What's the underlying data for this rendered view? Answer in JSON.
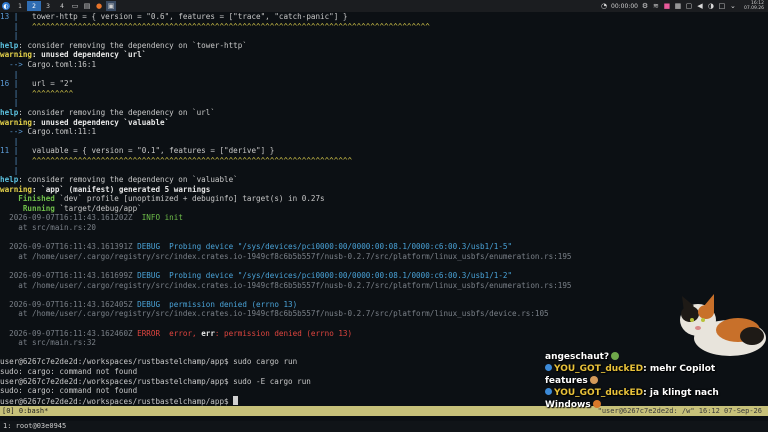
{
  "taskbar": {
    "workspaces": [
      "1",
      "2",
      "3",
      "4"
    ],
    "active_workspace": "2",
    "timer": "00:00:00",
    "clock_time": "16:12",
    "clock_date": "07.09.26"
  },
  "terminal": {
    "lines": [
      {
        "type": "code",
        "num": "13",
        "text": "tower-http = { version = \"0.6\", features = [\"trace\", \"catch-panic\"] }"
      },
      {
        "type": "under",
        "text": "^^^^^^^^^^^^^^^^^^^^^^^^^^^^^^^^^^^^^^^^^^^^^^^^^^^^^^^^^^^^^^^^^^^^^^^^^^^^^^^^^^^^^^^"
      },
      {
        "type": "bar"
      },
      {
        "type": "help",
        "label": "help",
        "text": ": consider removing the dependency on `tower-http`"
      },
      {
        "type": "warn",
        "label": "warning",
        "text": ": unused dependency `url`"
      },
      {
        "type": "arrow",
        "text": "Cargo.toml:16:1"
      },
      {
        "type": "bar"
      },
      {
        "type": "code",
        "num": "16",
        "text": "url = \"2\""
      },
      {
        "type": "under",
        "text": "^^^^^^^^^"
      },
      {
        "type": "bar"
      },
      {
        "type": "help",
        "label": "help",
        "text": ": consider removing the dependency on `url`"
      },
      {
        "type": "warn",
        "label": "warning",
        "text": ": unused dependency `valuable`"
      },
      {
        "type": "arrow",
        "text": "Cargo.toml:11:1"
      },
      {
        "type": "bar"
      },
      {
        "type": "code",
        "num": "11",
        "text": "valuable = { version = \"0.1\", features = [\"derive\"] }"
      },
      {
        "type": "under",
        "text": "^^^^^^^^^^^^^^^^^^^^^^^^^^^^^^^^^^^^^^^^^^^^^^^^^^^^^^^^^^^^^^^^^^^^^^"
      },
      {
        "type": "bar"
      },
      {
        "type": "help",
        "label": "help",
        "text": ": consider removing the dependency on `valuable`"
      },
      {
        "type": "warn",
        "label": "warning",
        "text": ": `app` (manifest) generated 5 warnings"
      },
      {
        "type": "status",
        "label": "    Finished",
        "text": " `dev` profile [unoptimized + debuginfo] target(s) in 0.27s"
      },
      {
        "type": "status",
        "label": "     Running",
        "text": " `target/debug/app`"
      },
      {
        "type": "log",
        "ts": "  2026-09-07T16:11:43.161202Z",
        "level": "  INFO",
        "lvl": "info",
        "msg": " init",
        "msgcls": "info"
      },
      {
        "type": "at",
        "text": "    at src/main.rs:20"
      },
      {
        "type": "blank"
      },
      {
        "type": "log",
        "ts": "  2026-09-07T16:11:43.161391Z",
        "level": " DEBUG",
        "lvl": "debug",
        "msg": "  Probing device \"/sys/devices/pci0000:00/0000:00:08.1/0000:c6:00.3/usb1/1-5\"",
        "msgcls": "debug"
      },
      {
        "type": "at",
        "text": "    at /home/user/.cargo/registry/src/index.crates.io-1949cf8c6b5b557f/nusb-0.2.7/src/platform/linux_usbfs/enumeration.rs:195"
      },
      {
        "type": "blank"
      },
      {
        "type": "log",
        "ts": "  2026-09-07T16:11:43.161699Z",
        "level": " DEBUG",
        "lvl": "debug",
        "msg": "  Probing device \"/sys/devices/pci0000:00/0000:00:08.1/0000:c6:00.3/usb1/1-2\"",
        "msgcls": "debug"
      },
      {
        "type": "at",
        "text": "    at /home/user/.cargo/registry/src/index.crates.io-1949cf8c6b5b557f/nusb-0.2.7/src/platform/linux_usbfs/enumeration.rs:195"
      },
      {
        "type": "blank"
      },
      {
        "type": "log",
        "ts": "  2026-09-07T16:11:43.162405Z",
        "level": " DEBUG",
        "lvl": "debug",
        "msg": "  permission denied (errno 13)",
        "msgcls": "debug"
      },
      {
        "type": "at",
        "text": "    at /home/user/.cargo/registry/src/index.crates.io-1949cf8c6b5b557f/nusb-0.2.7/src/platform/linux_usbfs/device.rs:105"
      },
      {
        "type": "blank"
      },
      {
        "type": "logerr",
        "ts": "  2026-09-07T16:11:43.162460Z",
        "level": " ERROR",
        "msg1": "  error, ",
        "msg2": "err",
        "msg3": ": permission denied (errno 13)"
      },
      {
        "type": "at",
        "text": "    at src/main.rs:32"
      },
      {
        "type": "blank"
      },
      {
        "type": "plain",
        "text": "user@6267c7e2de2d:/workspaces/rustbastelchamp/app$ sudo cargo run"
      },
      {
        "type": "plain",
        "text": "sudo: cargo: command not found"
      },
      {
        "type": "plain",
        "text": "user@6267c7e2de2d:/workspaces/rustbastelchamp/app$ sudo -E cargo run"
      },
      {
        "type": "plain",
        "text": "sudo: cargo: command not found"
      },
      {
        "type": "prompt",
        "text": "user@6267c7e2de2d:/workspaces/rustbastelchamp/app$ "
      }
    ]
  },
  "tmux": {
    "left": "[0] 0:bash*",
    "right": "\"user@6267c7e2de2d: /w\" 16:12 07-Sep-26"
  },
  "bottom": {
    "tab": "1: root@03e0945"
  },
  "chat": {
    "line0": "angeschaut?",
    "msg1_user": "YOU_GOT_duckED",
    "msg1_text": ": mehr Copilot",
    "msg1_cont": "features",
    "msg2_user": "YOU_GOT_duckED",
    "msg2_text": ": ja klingt nach",
    "msg2_cont": "Windows"
  },
  "colors": {
    "help": "#5bc0de",
    "warning": "#e6d34a",
    "error": "#e0453f",
    "debug": "#4aa3d8",
    "info": "#6fbf4a",
    "tmux_bar": "#c7c17a"
  }
}
